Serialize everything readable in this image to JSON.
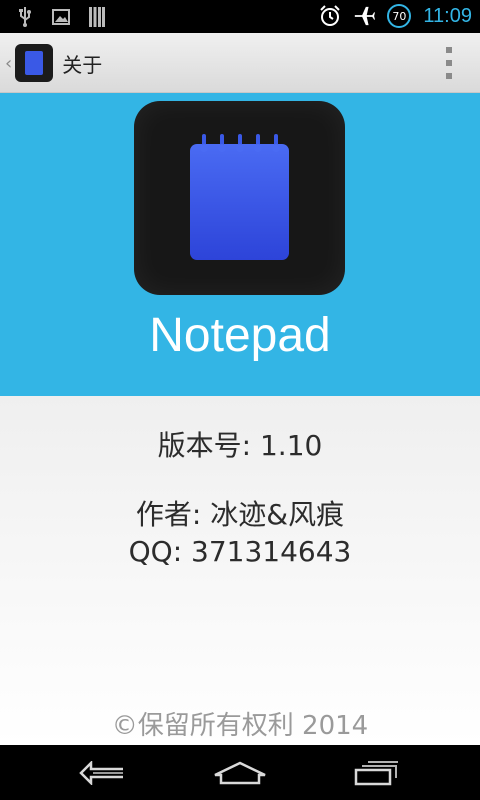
{
  "status_bar": {
    "icons": [
      "usb-icon",
      "image-icon",
      "storage-icon",
      "alarm-icon",
      "airplane-mode-icon"
    ],
    "battery_level": "70",
    "time": "11:09"
  },
  "action_bar": {
    "title": "关于",
    "icons": [
      "up-caret-icon",
      "notepad-app-icon",
      "overflow-menu-icon"
    ]
  },
  "hero": {
    "app_name": "Notepad",
    "icon": "notepad-icon",
    "background_color": "#33b5e5"
  },
  "info": {
    "version": "版本号: 1.10",
    "author": "作者: 冰迹&风痕",
    "qq": "QQ: 371314643",
    "copyright": "©保留所有权利 2014"
  },
  "nav_bar": {
    "buttons": [
      "back-icon",
      "home-icon",
      "recent-apps-icon"
    ]
  }
}
